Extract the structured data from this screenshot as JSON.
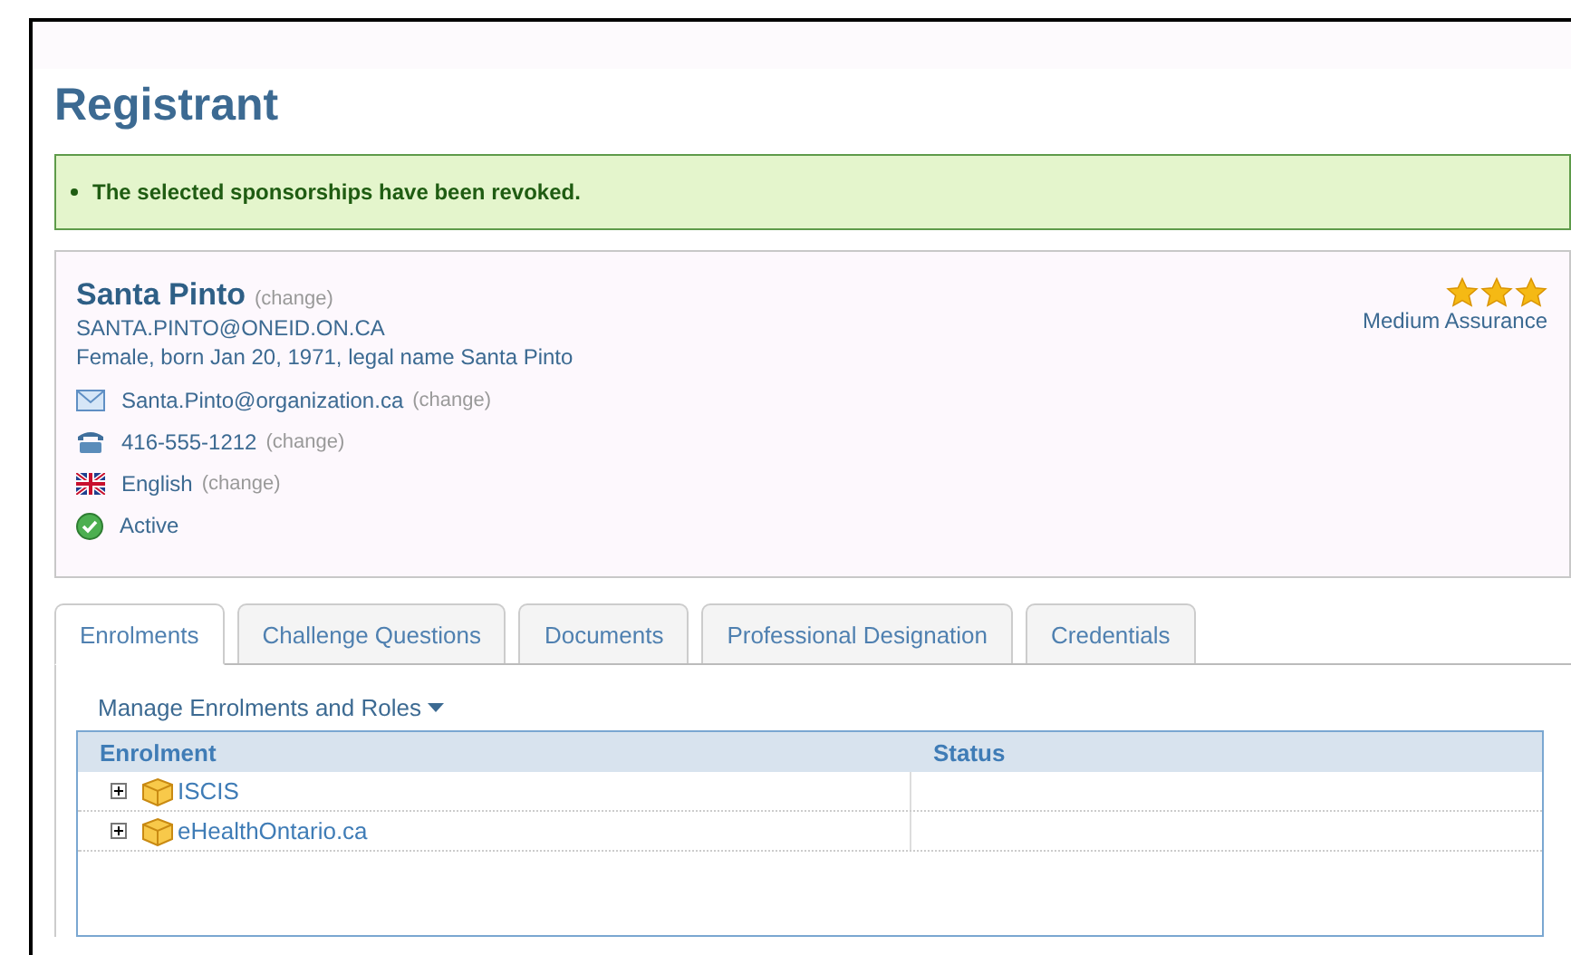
{
  "page_title": "Registrant",
  "alert": {
    "message": "The selected sponsorships have been revoked."
  },
  "profile": {
    "name": "Santa Pinto",
    "name_change": "(change)",
    "user_id": "SANTA.PINTO@ONEID.ON.CA",
    "details": "Female, born Jan 20, 1971, legal name Santa Pinto",
    "assurance": {
      "stars": 3,
      "label": "Medium Assurance"
    },
    "contacts": [
      {
        "kind": "email",
        "value": "Santa.Pinto@organization.ca",
        "change": "(change)"
      },
      {
        "kind": "phone",
        "value": "416-555-1212",
        "change": "(change)"
      },
      {
        "kind": "language",
        "value": "English",
        "change": "(change)"
      },
      {
        "kind": "status",
        "value": "Active"
      }
    ]
  },
  "tabs": [
    {
      "label": "Enrolments",
      "selected": true
    },
    {
      "label": "Challenge Questions",
      "selected": false
    },
    {
      "label": "Documents",
      "selected": false
    },
    {
      "label": "Professional Designation",
      "selected": false
    },
    {
      "label": "Credentials",
      "selected": false
    }
  ],
  "manage_menu": "Manage Enrolments and Roles",
  "table": {
    "columns": [
      "Enrolment",
      "Status"
    ],
    "rows": [
      {
        "name": "ISCIS",
        "expanded": false
      },
      {
        "name": "eHealthOntario.ca",
        "expanded": false
      }
    ]
  }
}
